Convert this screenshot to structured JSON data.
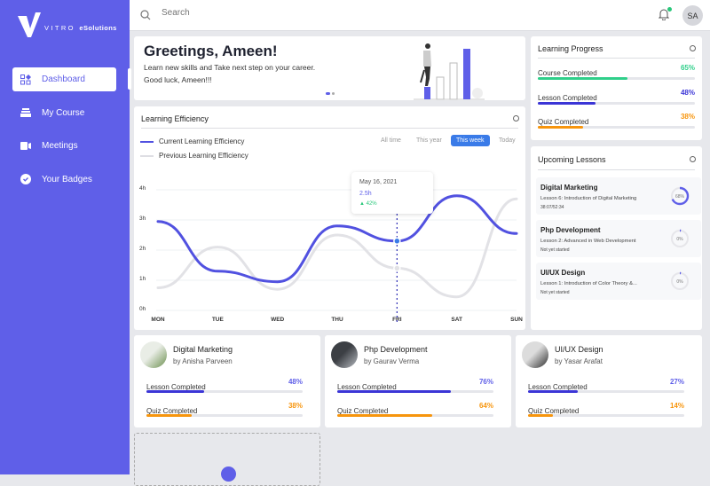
{
  "brand": {
    "logo_word": "VITRO",
    "logo_suffix": "eSolutions",
    "accent": "#5f5fe8"
  },
  "sidebar": {
    "items": [
      {
        "label": "Dashboard",
        "icon": "dashboard-icon",
        "active": true
      },
      {
        "label": "My Course",
        "icon": "course-icon",
        "active": false
      },
      {
        "label": "Meetings",
        "icon": "video-icon",
        "active": false
      },
      {
        "label": "Your Badges",
        "icon": "badge-check-icon",
        "active": false
      }
    ]
  },
  "topbar": {
    "search_placeholder": "Search",
    "avatar_initials": "SA",
    "has_notification": true
  },
  "greeting": {
    "title": "Greetings, Ameen!",
    "line1": "Learn new skills and Take next step on your career.",
    "line2": "Good luck, Ameen!!!"
  },
  "efficiency": {
    "title": "Learning Efficiency",
    "legend_current": "Current Learning Efficiency",
    "legend_previous": "Previous Learning Efficiency",
    "ranges": [
      "All time",
      "This year",
      "This week",
      "Today"
    ],
    "active_range": "This week",
    "tooltip": {
      "date": "May 16, 2021",
      "value": "2.5h",
      "change": "42%"
    }
  },
  "chart_data": {
    "type": "line",
    "title": "Learning Efficiency",
    "categories": [
      "MON",
      "TUE",
      "WED",
      "THU",
      "FRI",
      "SAT",
      "SUN"
    ],
    "y_ticks": [
      "0h",
      "1h",
      "2h",
      "3h",
      "4h"
    ],
    "ylim": [
      0,
      4
    ],
    "series": [
      {
        "name": "Current Learning Efficiency",
        "color": "#5151e0",
        "values": [
          2.95,
          1.3,
          0.95,
          2.8,
          2.3,
          3.8,
          2.55
        ]
      },
      {
        "name": "Previous Learning Efficiency",
        "color": "#e2e2e6",
        "values": [
          0.75,
          2.1,
          0.7,
          2.5,
          1.4,
          0.45,
          3.7
        ]
      }
    ],
    "highlight": {
      "category": "FRI",
      "current": 2.3,
      "previous": 1.4
    }
  },
  "progress": {
    "title": "Learning Progress",
    "rows": [
      {
        "label": "Course Completed",
        "pct": "65%",
        "value": 0.57,
        "color": "#2fcf8a"
      },
      {
        "label": "Lesson Completed",
        "pct": "48%",
        "value": 0.37,
        "color": "#3b35d6"
      },
      {
        "label": "Quiz Completed",
        "pct": "38%",
        "value": 0.29,
        "color": "#f7950d"
      }
    ]
  },
  "upcoming": {
    "title": "Upcoming Lessons",
    "lessons": [
      {
        "title": "Digital Marketing",
        "subtitle": "Lesson 6: Introduction of Digital Marketing",
        "meta": "38:07/52:34",
        "pct": "68%",
        "value": 0.68
      },
      {
        "title": "Php Development",
        "subtitle": "Lesson 2: Advanced in Web Development",
        "meta": "Not yet started",
        "pct": "0%",
        "value": 0
      },
      {
        "title": "UI/UX Design",
        "subtitle": "Lesson 1: Introduction of Color Theory &...",
        "meta": "Not yet started",
        "pct": "0%",
        "value": 0
      }
    ]
  },
  "courses": [
    {
      "title": "Digital Marketing",
      "author": "by Anisha Parveen",
      "lesson_label": "Lesson Completed",
      "lesson_pct": "48%",
      "lesson_value": 0.37,
      "quiz_label": "Quiz Completed",
      "quiz_pct": "38%",
      "quiz_value": 0.29
    },
    {
      "title": "Php Development",
      "author": "by Gaurav Verma",
      "lesson_label": "Lesson Completed",
      "lesson_pct": "76%",
      "lesson_value": 0.73,
      "quiz_label": "Quiz Completed",
      "quiz_pct": "64%",
      "quiz_value": 0.61
    },
    {
      "title": "UI/UX Design",
      "author": "by Yasar Arafat",
      "lesson_label": "Lesson Completed",
      "lesson_pct": "27%",
      "lesson_value": 0.32,
      "quiz_label": "Quiz Completed",
      "quiz_pct": "14%",
      "quiz_value": 0.16
    }
  ]
}
